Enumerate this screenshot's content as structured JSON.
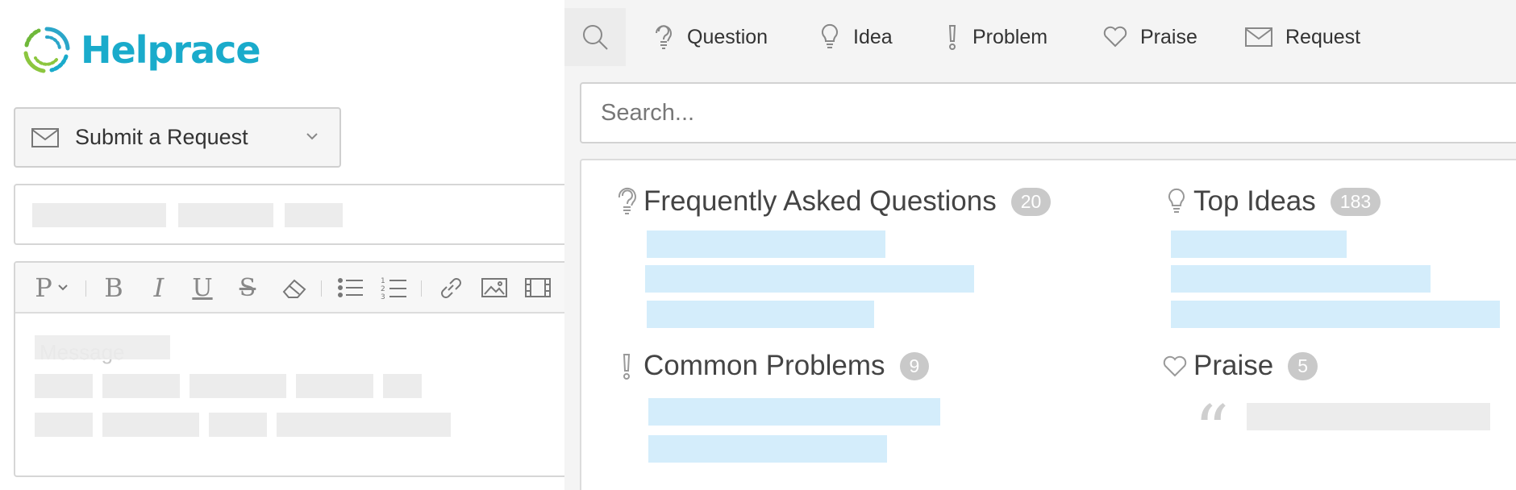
{
  "brand": {
    "name": "Helprace",
    "logo_icon": "helprace-ring-logo",
    "colors": {
      "brand": "#1aabcb",
      "ring_blue": "#2ba6c9",
      "ring_green": "#8cc63f"
    }
  },
  "submit_dropdown": {
    "label": "Submit a Request",
    "icon": "envelope-icon"
  },
  "editor": {
    "toolbar": [
      {
        "name": "paragraph-format",
        "glyph": "P"
      },
      {
        "name": "bold",
        "glyph": "B"
      },
      {
        "name": "italic",
        "glyph": "I"
      },
      {
        "name": "underline",
        "glyph": "U"
      },
      {
        "name": "strikethrough",
        "glyph": "S"
      },
      {
        "name": "clear-format",
        "icon": "eraser-icon"
      },
      {
        "name": "bullet-list",
        "icon": "list-bulleted-icon"
      },
      {
        "name": "numbered-list",
        "icon": "list-numbered-icon"
      },
      {
        "name": "link",
        "icon": "link-icon"
      },
      {
        "name": "image",
        "icon": "image-icon"
      },
      {
        "name": "video",
        "icon": "film-icon"
      }
    ],
    "message_placeholder": "Message"
  },
  "tabs": [
    {
      "label": "",
      "icon": "search-icon"
    },
    {
      "label": "Question",
      "icon": "question-bulb-icon"
    },
    {
      "label": "Idea",
      "icon": "lightbulb-icon"
    },
    {
      "label": "Problem",
      "icon": "exclamation-icon"
    },
    {
      "label": "Praise",
      "icon": "heart-icon"
    },
    {
      "label": "Request",
      "icon": "envelope-icon"
    }
  ],
  "search": {
    "placeholder": "Search..."
  },
  "sections": {
    "faq": {
      "title": "Frequently Asked Questions",
      "count": "20",
      "icon": "question-bulb-icon"
    },
    "ideas": {
      "title": "Top Ideas",
      "count": "183",
      "icon": "lightbulb-icon"
    },
    "problems": {
      "title": "Common Problems",
      "count": "9",
      "icon": "exclamation-icon"
    },
    "praise": {
      "title": "Praise",
      "count": "5",
      "icon": "heart-icon",
      "quote_icon": "quote-icon"
    }
  },
  "colors": {
    "link_placeholder": "#d4edfb",
    "text_placeholder": "#ececec",
    "badge": "#c9c9c9",
    "right_bg": "#f4f4f4"
  }
}
